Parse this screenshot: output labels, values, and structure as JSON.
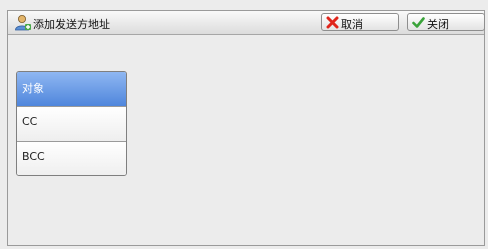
{
  "header": {
    "title": "添加发送方地址",
    "title_icon": "user-add-icon",
    "cancel_label": "取消",
    "cancel_icon": "red-x-icon",
    "close_label": "关闭",
    "close_icon": "green-check-icon"
  },
  "recipient_types": {
    "items": [
      {
        "label": "对象",
        "selected": true
      },
      {
        "label": "CC",
        "selected": false
      },
      {
        "label": "BCC",
        "selected": false
      }
    ]
  },
  "colors": {
    "selected_bg": "#4f86dc",
    "cancel_x": "#e0251b",
    "close_check": "#3aa33a"
  }
}
